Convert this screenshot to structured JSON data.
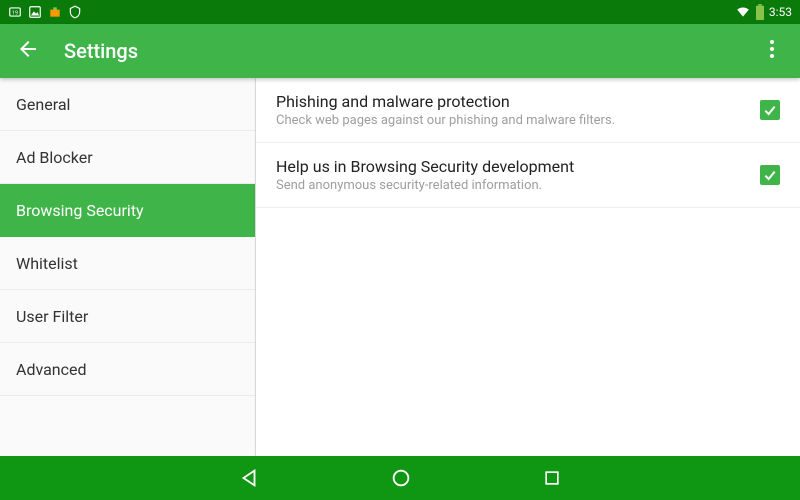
{
  "status": {
    "time": "3:53"
  },
  "header": {
    "title": "Settings"
  },
  "sidebar": {
    "items": [
      {
        "label": "General"
      },
      {
        "label": "Ad Blocker"
      },
      {
        "label": "Browsing Security"
      },
      {
        "label": "Whitelist"
      },
      {
        "label": "User Filter"
      },
      {
        "label": "Advanced"
      }
    ],
    "activeIndex": 2
  },
  "settings": [
    {
      "title": "Phishing and malware protection",
      "subtitle": "Check web pages against our phishing and malware filters.",
      "checked": true
    },
    {
      "title": "Help us in Browsing Security development",
      "subtitle": "Send anonymous security-related information.",
      "checked": true
    }
  ],
  "colors": {
    "primary": "#3fb549",
    "primaryDark": "#0a7a0a",
    "navBar": "#0f9613"
  }
}
